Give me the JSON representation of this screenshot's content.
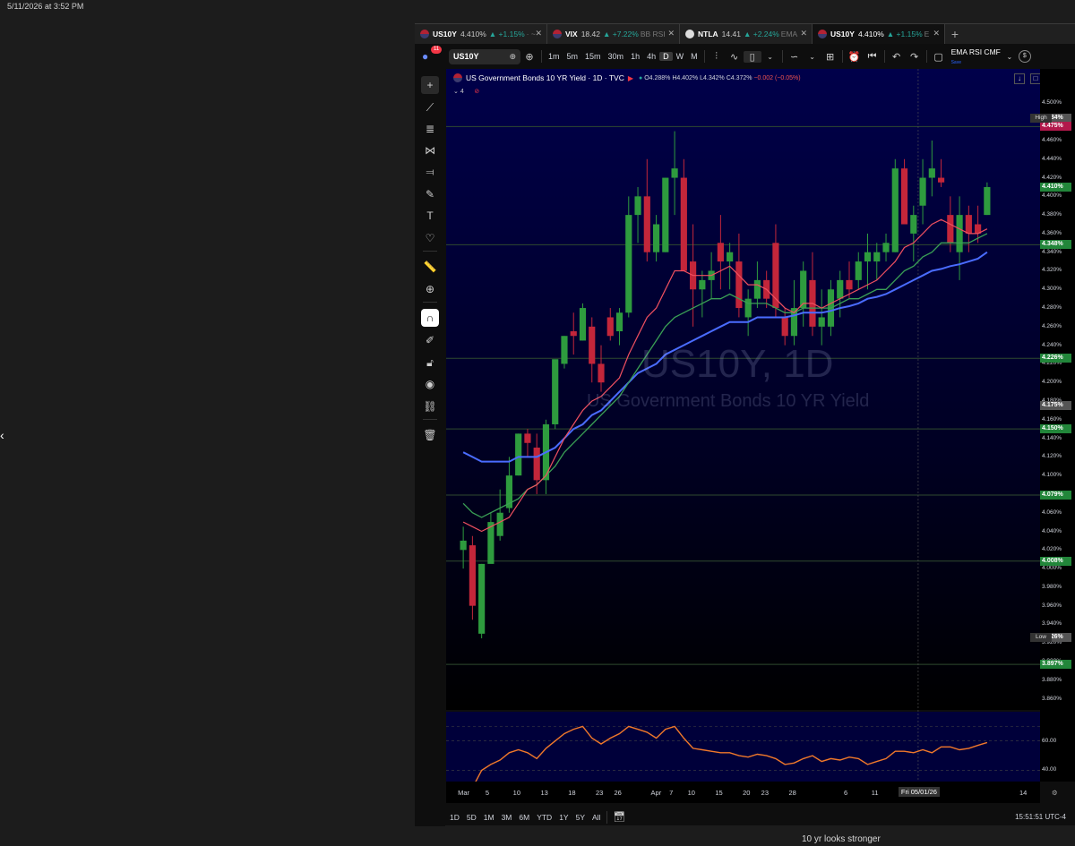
{
  "page_stamp": "5/11/2026 at 3:52 PM",
  "caption": "10 yr looks stronger",
  "tabs": [
    {
      "symbol": "US10Y",
      "value": "4.410%",
      "change": "▲ +1.15%",
      "extra": "· ~",
      "active": false
    },
    {
      "symbol": "VIX",
      "value": "18.42",
      "change": "▲ +7.22%",
      "extra": "BB RSI",
      "active": false
    },
    {
      "symbol": "NTLA",
      "value": "14.41",
      "change": "▲ +2.24%",
      "extra": "EMA",
      "active": false
    },
    {
      "symbol": "US10Y",
      "value": "4.410%",
      "change": "▲ +1.15%",
      "extra": "E",
      "active": true
    }
  ],
  "toolbar": {
    "badge": "11",
    "symbol": "US10Y",
    "timeframes": [
      "1m",
      "5m",
      "15m",
      "30m",
      "1h",
      "4h",
      "D",
      "W",
      "M"
    ],
    "active_timeframe": "D",
    "indicators": "EMA RSI CMF",
    "indicators_sub": "Save",
    "percent": "%"
  },
  "legend": {
    "title": "US Government Bonds 10 YR Yield · 1D · TVC",
    "open": "O4.288%",
    "high": "H4.402%",
    "low": "L4.342%",
    "close": "C4.372%",
    "change": "−0.002 (−0.05%)",
    "indicator_count": "4"
  },
  "watermark": {
    "symbol": "US10Y, 1D",
    "name": "US Government Bonds 10 YR Yield"
  },
  "price_scale": {
    "ticks": [
      "4.500%",
      "4.480%",
      "4.460%",
      "4.440%",
      "4.420%",
      "4.400%",
      "4.380%",
      "4.360%",
      "4.340%",
      "4.320%",
      "4.300%",
      "4.280%",
      "4.260%",
      "4.240%",
      "4.220%",
      "4.200%",
      "4.180%",
      "4.160%",
      "4.140%",
      "4.120%",
      "4.100%",
      "4.080%",
      "4.060%",
      "4.040%",
      "4.020%",
      "4.000%",
      "3.980%",
      "3.960%",
      "3.940%",
      "3.920%",
      "3.900%",
      "3.880%",
      "3.860%"
    ],
    "tags": [
      {
        "label": "4.484%",
        "color": "#555555"
      },
      {
        "label": "4.475%",
        "color": "#b2184b"
      },
      {
        "label": "4.410%",
        "color": "#22863a"
      },
      {
        "label": "4.348%",
        "color": "#22863a"
      },
      {
        "label": "4.226%",
        "color": "#22863a"
      },
      {
        "label": "4.175%",
        "color": "#555555"
      },
      {
        "label": "4.150%",
        "color": "#22863a"
      },
      {
        "label": "4.079%",
        "color": "#22863a"
      },
      {
        "label": "4.008%",
        "color": "#22863a"
      },
      {
        "label": "3.926%",
        "color": "#555555"
      },
      {
        "label": "3.897%",
        "color": "#22863a"
      }
    ],
    "high_label": "High",
    "low_label": "Low",
    "rsi_ticks": [
      "60.00",
      "40.00"
    ]
  },
  "time_axis": [
    "Mar",
    "5",
    "10",
    "13",
    "18",
    "23",
    "26",
    "Apr",
    "7",
    "10",
    "15",
    "20",
    "23",
    "28",
    "Fri 05/01/26",
    "6",
    "11",
    "14"
  ],
  "ranges": [
    "1D",
    "5D",
    "1M",
    "3M",
    "6M",
    "YTD",
    "1Y",
    "5Y",
    "All"
  ],
  "clock": "15:51:51 UTC-4",
  "colors": {
    "up": "#26a69a",
    "down": "#ef5350",
    "ema_fast": "#f05060",
    "ema_mid": "#3aa055",
    "ema_slow": "#4a6cff",
    "rsi": "#f0782a",
    "chart_bg": "#000033"
  },
  "chart_data": {
    "type": "candlestick",
    "yrange": [
      3.85,
      4.51
    ],
    "candles": [
      [
        4.02,
        4.045,
        4.0,
        4.03
      ],
      [
        4.025,
        4.035,
        3.945,
        3.96
      ],
      [
        3.93,
        4.005,
        3.925,
        4.005
      ],
      [
        4.005,
        4.06,
        4.03,
        4.05
      ],
      [
        4.035,
        4.085,
        4.03,
        4.06
      ],
      [
        4.065,
        4.12,
        4.06,
        4.1
      ],
      [
        4.1,
        4.145,
        4.1,
        4.145
      ],
      [
        4.145,
        4.15,
        4.12,
        4.135
      ],
      [
        4.13,
        4.145,
        4.08,
        4.095
      ],
      [
        4.095,
        4.16,
        4.08,
        4.155
      ],
      [
        4.155,
        4.22,
        4.15,
        4.225
      ],
      [
        4.22,
        4.25,
        4.215,
        4.25
      ],
      [
        4.255,
        4.275,
        4.23,
        4.25
      ],
      [
        4.245,
        4.285,
        4.245,
        4.28
      ],
      [
        4.26,
        4.27,
        4.2,
        4.22
      ],
      [
        4.22,
        4.24,
        4.19,
        4.2
      ],
      [
        4.27,
        4.28,
        4.245,
        4.25
      ],
      [
        4.255,
        4.28,
        4.24,
        4.275
      ],
      [
        4.275,
        4.4,
        4.27,
        4.38
      ],
      [
        4.38,
        4.41,
        4.35,
        4.4
      ],
      [
        4.4,
        4.44,
        4.33,
        4.34
      ],
      [
        4.34,
        4.38,
        4.33,
        4.37
      ],
      [
        4.34,
        4.42,
        4.34,
        4.42
      ],
      [
        4.42,
        4.47,
        4.38,
        4.43
      ],
      [
        4.42,
        4.44,
        4.32,
        4.32
      ],
      [
        4.33,
        4.37,
        4.26,
        4.3
      ],
      [
        4.3,
        4.32,
        4.27,
        4.31
      ],
      [
        4.31,
        4.34,
        4.29,
        4.32
      ],
      [
        4.35,
        4.38,
        4.3,
        4.33
      ],
      [
        4.33,
        4.35,
        4.3,
        4.34
      ],
      [
        4.33,
        4.36,
        4.27,
        4.28
      ],
      [
        4.27,
        4.3,
        4.25,
        4.29
      ],
      [
        4.29,
        4.33,
        4.28,
        4.31
      ],
      [
        4.31,
        4.32,
        4.28,
        4.29
      ],
      [
        4.35,
        4.37,
        4.27,
        4.28
      ],
      [
        4.27,
        4.28,
        4.24,
        4.25
      ],
      [
        4.25,
        4.31,
        4.24,
        4.28
      ],
      [
        4.28,
        4.33,
        4.26,
        4.32
      ],
      [
        4.31,
        4.34,
        4.25,
        4.26
      ],
      [
        4.26,
        4.3,
        4.24,
        4.27
      ],
      [
        4.26,
        4.31,
        4.25,
        4.3
      ],
      [
        4.29,
        4.32,
        4.27,
        4.31
      ],
      [
        4.31,
        4.33,
        4.29,
        4.3
      ],
      [
        4.31,
        4.34,
        4.3,
        4.33
      ],
      [
        4.33,
        4.36,
        4.3,
        4.34
      ],
      [
        4.33,
        4.35,
        4.31,
        4.34
      ],
      [
        4.34,
        4.36,
        4.33,
        4.35
      ],
      [
        4.34,
        4.44,
        4.34,
        4.43
      ],
      [
        4.43,
        4.44,
        4.37,
        4.37
      ],
      [
        4.36,
        4.39,
        4.33,
        4.38
      ],
      [
        4.39,
        4.44,
        4.37,
        4.42
      ],
      [
        4.42,
        4.46,
        4.4,
        4.43
      ],
      [
        4.42,
        4.44,
        4.41,
        4.415
      ],
      [
        4.38,
        4.4,
        4.34,
        4.35
      ],
      [
        4.34,
        4.4,
        4.31,
        4.38
      ],
      [
        4.38,
        4.39,
        4.34,
        4.36
      ],
      [
        4.37,
        4.39,
        4.35,
        4.36
      ],
      [
        4.38,
        4.415,
        4.38,
        4.41
      ]
    ],
    "ema_fast": [
      4.05,
      4.045,
      4.04,
      4.045,
      4.05,
      4.055,
      4.07,
      4.085,
      4.09,
      4.1,
      4.12,
      4.14,
      4.155,
      4.17,
      4.18,
      4.185,
      4.195,
      4.205,
      4.23,
      4.25,
      4.27,
      4.28,
      4.3,
      4.32,
      4.32,
      4.315,
      4.315,
      4.315,
      4.32,
      4.325,
      4.315,
      4.305,
      4.305,
      4.3,
      4.29,
      4.28,
      4.275,
      4.285,
      4.285,
      4.28,
      4.285,
      4.29,
      4.295,
      4.3,
      4.305,
      4.31,
      4.32,
      4.33,
      4.345,
      4.35,
      4.36,
      4.37,
      4.375,
      4.37,
      4.365,
      4.36,
      4.36,
      4.365
    ],
    "ema_mid": [
      4.07,
      4.06,
      4.055,
      4.06,
      4.065,
      4.07,
      4.075,
      4.085,
      4.09,
      4.1,
      4.11,
      4.125,
      4.135,
      4.145,
      4.155,
      4.165,
      4.175,
      4.185,
      4.2,
      4.215,
      4.23,
      4.245,
      4.26,
      4.27,
      4.275,
      4.28,
      4.285,
      4.29,
      4.29,
      4.295,
      4.29,
      4.285,
      4.285,
      4.285,
      4.28,
      4.275,
      4.275,
      4.28,
      4.28,
      4.28,
      4.28,
      4.285,
      4.29,
      4.29,
      4.295,
      4.3,
      4.3,
      4.31,
      4.32,
      4.325,
      4.335,
      4.34,
      4.35,
      4.35,
      4.35,
      4.35,
      4.355,
      4.36
    ],
    "ema_slow": [
      4.125,
      4.12,
      4.115,
      4.115,
      4.115,
      4.115,
      4.12,
      4.12,
      4.12,
      4.125,
      4.13,
      4.14,
      4.15,
      4.155,
      4.165,
      4.17,
      4.18,
      4.19,
      4.2,
      4.21,
      4.215,
      4.22,
      4.23,
      4.235,
      4.24,
      4.245,
      4.25,
      4.255,
      4.26,
      4.265,
      4.265,
      4.265,
      4.27,
      4.27,
      4.27,
      4.27,
      4.272,
      4.275,
      4.275,
      4.275,
      4.277,
      4.28,
      4.282,
      4.285,
      4.29,
      4.292,
      4.295,
      4.3,
      4.305,
      4.31,
      4.315,
      4.32,
      4.322,
      4.325,
      4.327,
      4.33,
      4.333,
      4.34
    ],
    "rsi": [
      30,
      28,
      40,
      44,
      47,
      52,
      54,
      52,
      48,
      55,
      60,
      65,
      68,
      70,
      62,
      58,
      62,
      65,
      70,
      68,
      66,
      62,
      68,
      70,
      62,
      55,
      54,
      53,
      52,
      52,
      50,
      49,
      51,
      50,
      48,
      44,
      45,
      48,
      50,
      46,
      48,
      47,
      49,
      48,
      44,
      46,
      48,
      53,
      53,
      52,
      54,
      52,
      56,
      56,
      54,
      55,
      57,
      59
    ],
    "rsi_range": [
      25,
      80
    ]
  }
}
